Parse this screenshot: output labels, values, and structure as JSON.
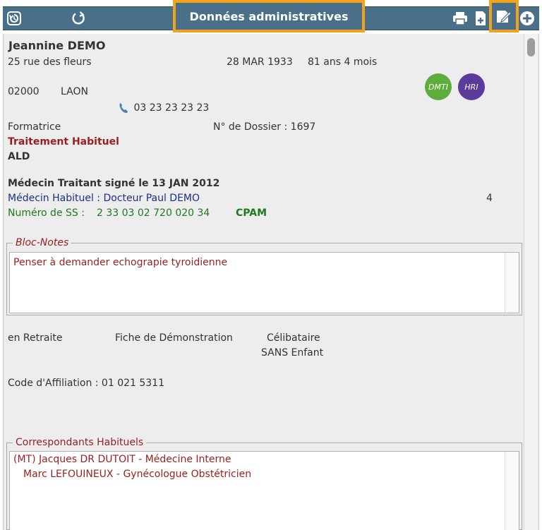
{
  "toolbar": {
    "title": "Données administratives",
    "left_icons": [
      "history-back-icon",
      "refresh-icon"
    ],
    "right_icons": [
      "print-icon",
      "add-document-icon",
      "edit-icon",
      "add-circle-icon"
    ],
    "highlight_color": "#f4a21c",
    "bar_color": "#4a7089"
  },
  "patient": {
    "name": "Jeannine DEMO",
    "address": "25 rue des fleurs",
    "birth_date": "28 MAR 1933",
    "age": "81 ans 4 mois",
    "postal_code": "02000",
    "city": "LAON",
    "phone": "03 23 23 23 23",
    "profession": "Formatrice",
    "dossier": "N° de Dossier : 1697",
    "treatment": "Traitement Habituel",
    "ald": "ALD",
    "badges": [
      "DMTI",
      "HRI"
    ]
  },
  "doctor": {
    "signed": "Médecin Traitant signé le 13 JAN 2012",
    "habitual": "Médecin Habituel : Docteur Paul DEMO",
    "count": "4",
    "ss_label": "Numéro de SS :",
    "ss_number": "2 33 03 02 720 020 34",
    "cpam": "CPAM"
  },
  "bloc_notes": {
    "legend": "Bloc-Notes",
    "text": "Penser à demander echograpie tyroidienne"
  },
  "situation": {
    "status": "en Retraite",
    "fiche": "Fiche de Démonstration",
    "marital": "Célibataire",
    "children": "SANS Enfant",
    "affiliation": "Code d'Affiliation : 01  021  5311"
  },
  "correspondants": {
    "legend": "Correspondants Habituels",
    "lines": [
      "(MT) Jacques DR DUTOIT - Médecine Interne",
      "Marc LEFOUINEUX - Gynécologue Obstétricien"
    ]
  }
}
